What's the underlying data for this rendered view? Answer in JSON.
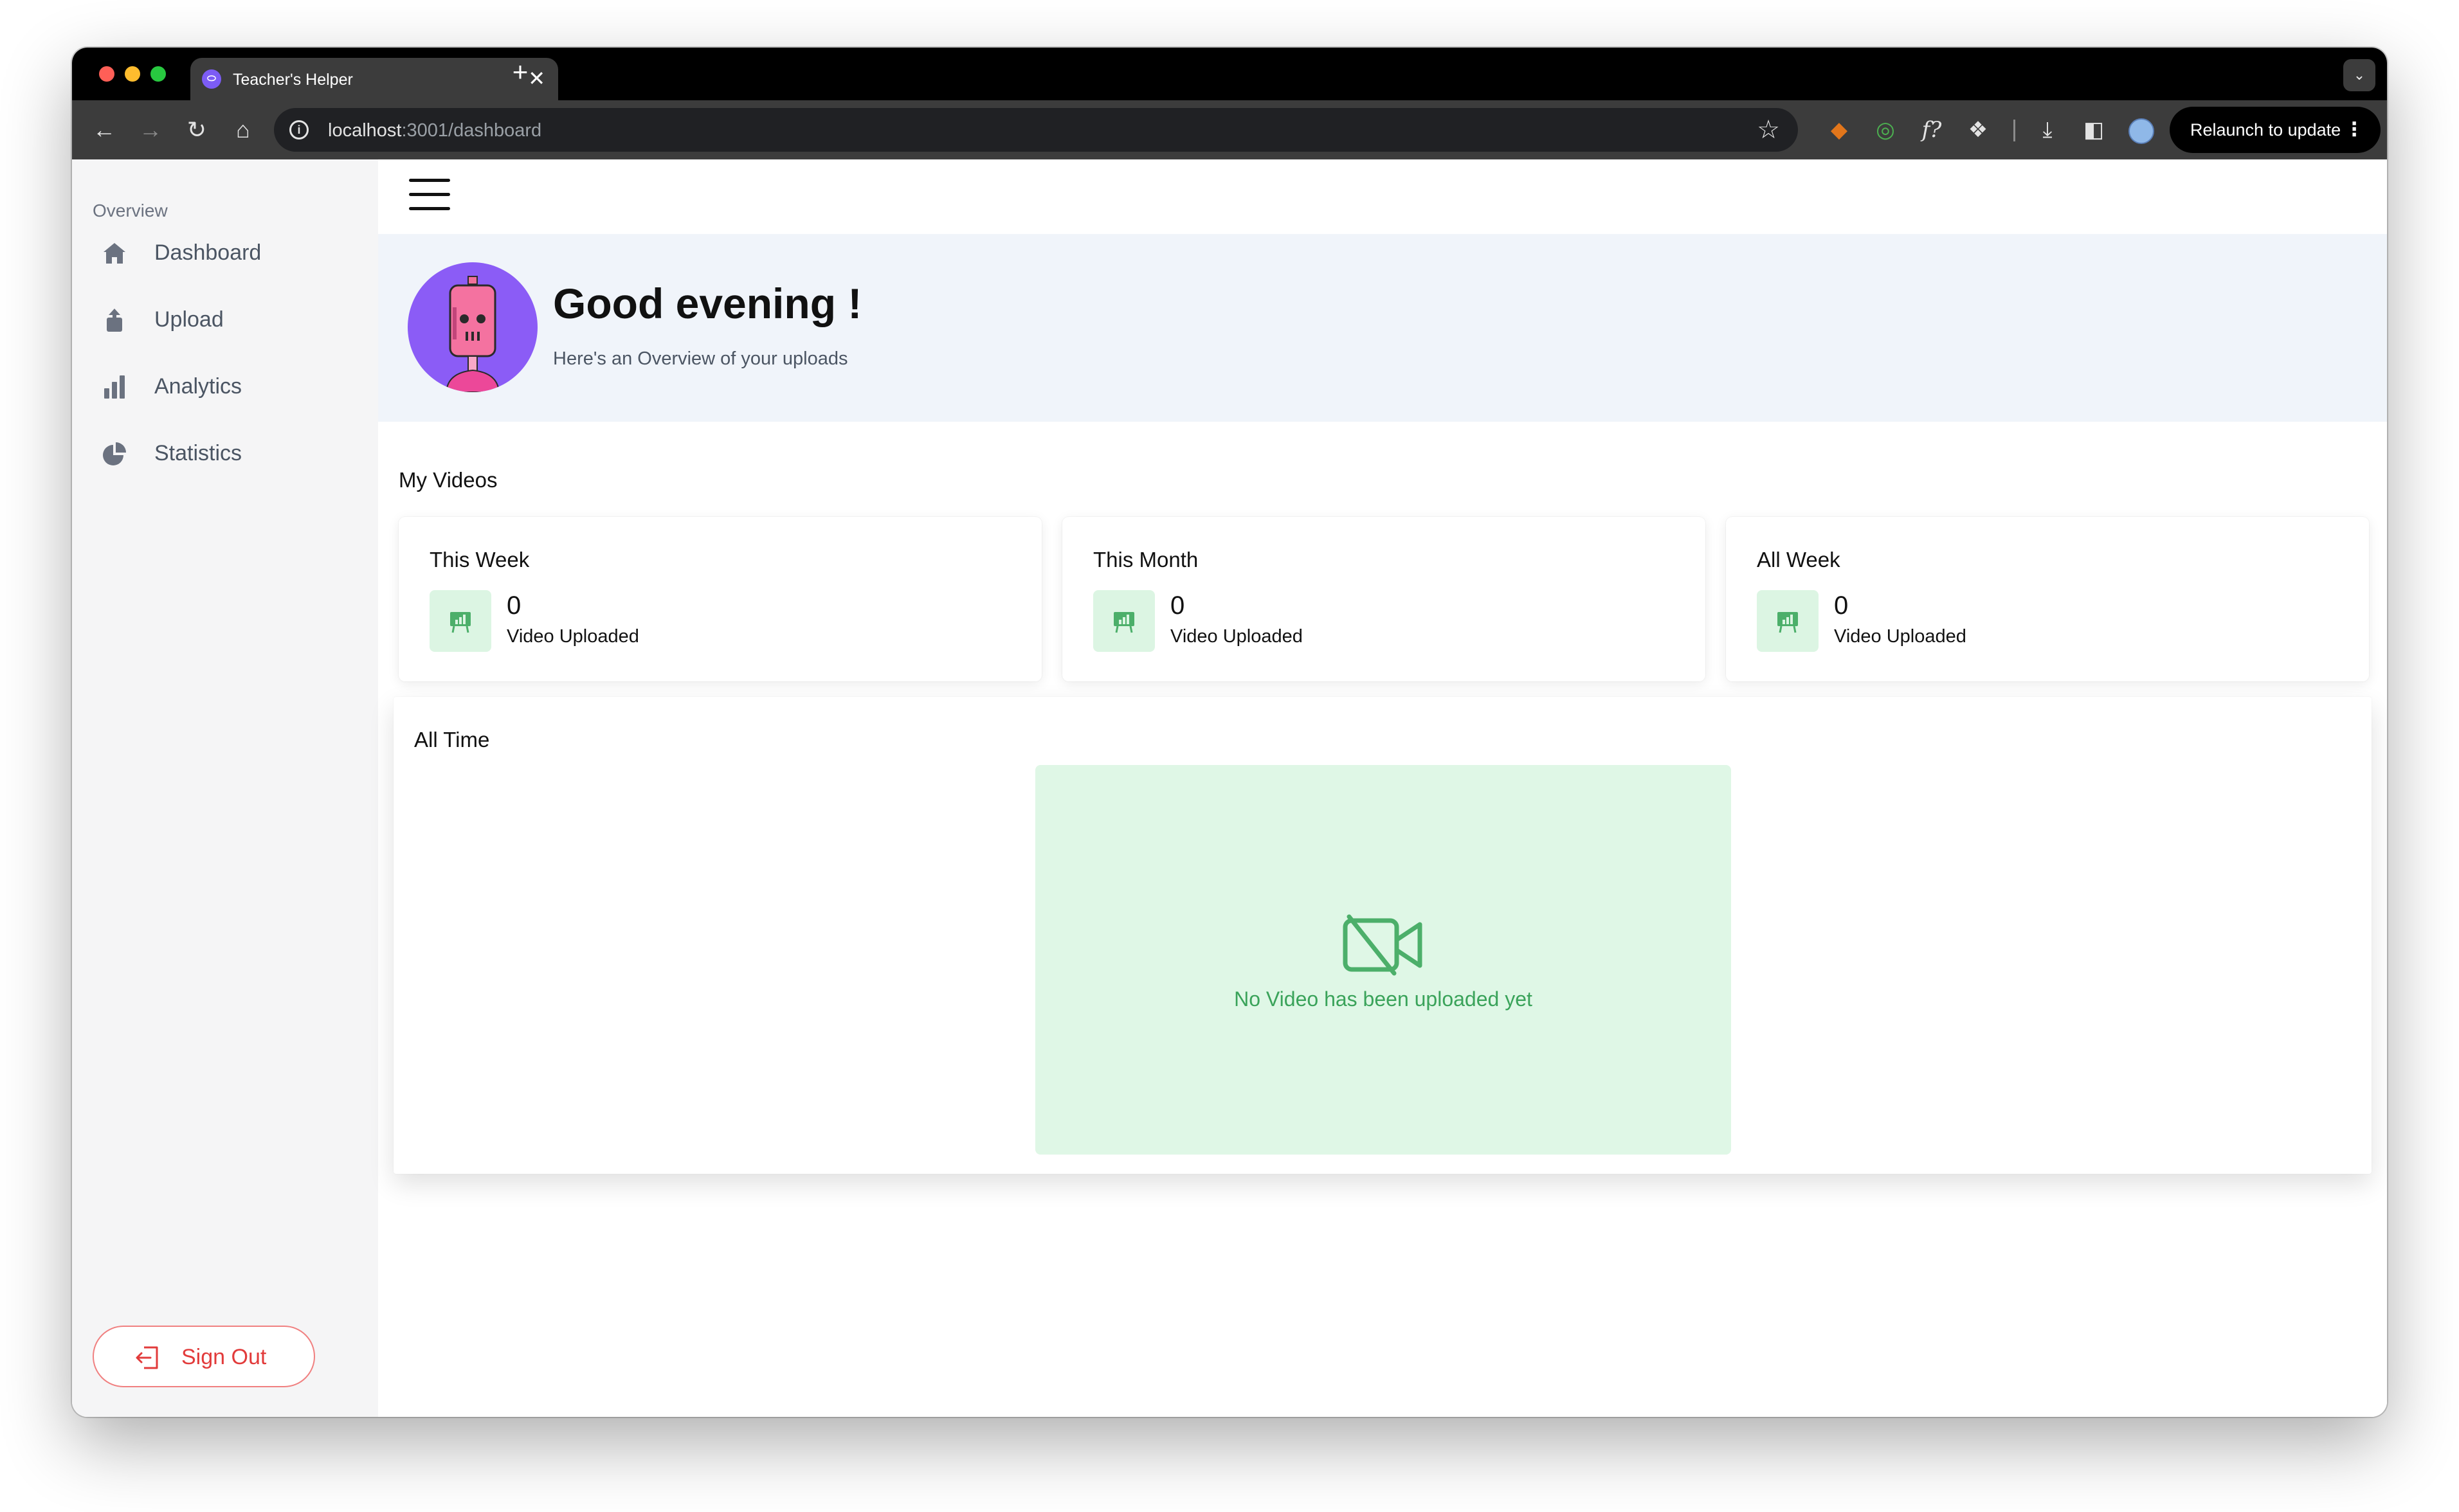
{
  "browser": {
    "tab_title": "Teacher's Helper",
    "tab_favicon": "⬭",
    "tab_close": "✕",
    "new_tab": "+",
    "tabs_dropdown": "⌄",
    "url_host": "localhost",
    "url_path": ":3001/dashboard",
    "relaunch_label": "Relaunch to update",
    "relaunch_menu": "⋮",
    "icons": {
      "back": "arrow-left-icon",
      "forward": "arrow-right-icon",
      "reload": "reload-icon",
      "home": "home-icon",
      "info": "info-icon",
      "bookmark": "star-icon",
      "extensions": [
        "fox-icon",
        "circle-icon",
        "function-icon",
        "puzzle-icon",
        "download-icon",
        "side-panel-icon"
      ]
    },
    "glyphs": {
      "back": "←",
      "forward": "→",
      "reload": "↻",
      "home": "⌂",
      "info": "i",
      "bookmark": "☆",
      "fox": "◆",
      "circle": "◎",
      "func": "f?",
      "puzzle": "❖",
      "download": "⤓",
      "side_panel": "◧"
    }
  },
  "sidebar": {
    "section_label": "Overview",
    "items": [
      {
        "label": "Dashboard",
        "icon": "home-icon"
      },
      {
        "label": "Upload",
        "icon": "upload-icon"
      },
      {
        "label": "Analytics",
        "icon": "bar-chart-icon"
      },
      {
        "label": "Statistics",
        "icon": "pie-chart-icon"
      }
    ],
    "sign_out_label": "Sign Out",
    "icon_color": "#6b7280"
  },
  "hero": {
    "greeting": "Good evening !",
    "subtitle": "Here's an Overview of your uploads"
  },
  "my_videos": {
    "title": "My Videos",
    "cards": [
      {
        "title": "This Week",
        "value": "0",
        "label": "Video Uploaded"
      },
      {
        "title": "This Month",
        "value": "0",
        "label": "Video Uploaded"
      },
      {
        "title": "All Week",
        "value": "0",
        "label": "Video Uploaded"
      }
    ]
  },
  "all_time": {
    "title": "All Time",
    "empty_message": "No Video has been uploaded yet"
  },
  "colors": {
    "accent_green": "#3aa35a",
    "light_green": "#dff7e6",
    "avatar_purple": "#8b5cf6",
    "sign_out_red": "#e23b3b",
    "hero_background": "#f0f4fa"
  }
}
